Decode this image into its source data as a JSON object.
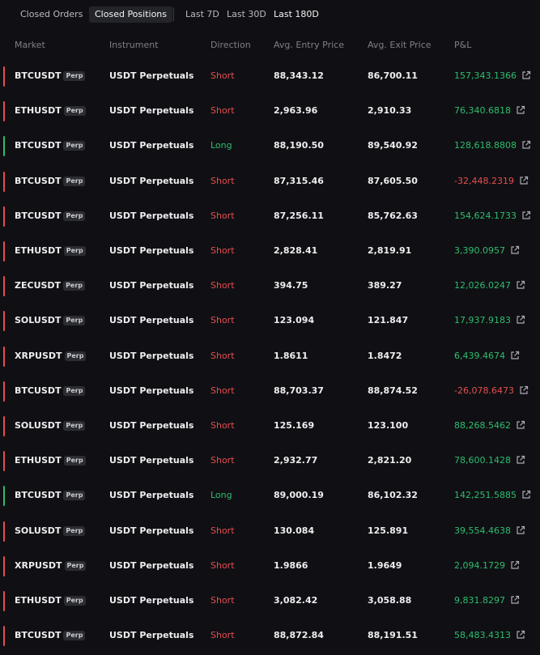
{
  "colors": {
    "short": "#e54e4e",
    "long": "#2ebd6e",
    "positive": "#2ebd6e",
    "negative": "#e54e4e"
  },
  "tabs": {
    "closed_orders": "Closed Orders",
    "closed_positions": "Closed Positions",
    "last_7d": "Last 7D",
    "last_30d": "Last 30D",
    "last_180d": "Last 180D"
  },
  "columns": {
    "market": "Market",
    "instrument": "Instrument",
    "direction": "Direction",
    "entry": "Avg. Entry Price",
    "exit": "Avg. Exit Price",
    "pnl": "P&L"
  },
  "badge_label": "Perp",
  "rows": [
    {
      "market": "BTCUSDT",
      "instrument": "USDT Perpetuals",
      "direction": "Short",
      "entry": "88,343.12",
      "exit": "86,700.11",
      "pnl": "157,343.1366"
    },
    {
      "market": "ETHUSDT",
      "instrument": "USDT Perpetuals",
      "direction": "Short",
      "entry": "2,963.96",
      "exit": "2,910.33",
      "pnl": "76,340.6818"
    },
    {
      "market": "BTCUSDT",
      "instrument": "USDT Perpetuals",
      "direction": "Long",
      "entry": "88,190.50",
      "exit": "89,540.92",
      "pnl": "128,618.8808"
    },
    {
      "market": "BTCUSDT",
      "instrument": "USDT Perpetuals",
      "direction": "Short",
      "entry": "87,315.46",
      "exit": "87,605.50",
      "pnl": "-32,448.2319"
    },
    {
      "market": "BTCUSDT",
      "instrument": "USDT Perpetuals",
      "direction": "Short",
      "entry": "87,256.11",
      "exit": "85,762.63",
      "pnl": "154,624.1733"
    },
    {
      "market": "ETHUSDT",
      "instrument": "USDT Perpetuals",
      "direction": "Short",
      "entry": "2,828.41",
      "exit": "2,819.91",
      "pnl": "3,390.0957"
    },
    {
      "market": "ZECUSDT",
      "instrument": "USDT Perpetuals",
      "direction": "Short",
      "entry": "394.75",
      "exit": "389.27",
      "pnl": "12,026.0247"
    },
    {
      "market": "SOLUSDT",
      "instrument": "USDT Perpetuals",
      "direction": "Short",
      "entry": "123.094",
      "exit": "121.847",
      "pnl": "17,937.9183"
    },
    {
      "market": "XRPUSDT",
      "instrument": "USDT Perpetuals",
      "direction": "Short",
      "entry": "1.8611",
      "exit": "1.8472",
      "pnl": "6,439.4674"
    },
    {
      "market": "BTCUSDT",
      "instrument": "USDT Perpetuals",
      "direction": "Short",
      "entry": "88,703.37",
      "exit": "88,874.52",
      "pnl": "-26,078.6473"
    },
    {
      "market": "SOLUSDT",
      "instrument": "USDT Perpetuals",
      "direction": "Short",
      "entry": "125.169",
      "exit": "123.100",
      "pnl": "88,268.5462"
    },
    {
      "market": "ETHUSDT",
      "instrument": "USDT Perpetuals",
      "direction": "Short",
      "entry": "2,932.77",
      "exit": "2,821.20",
      "pnl": "78,600.1428"
    },
    {
      "market": "BTCUSDT",
      "instrument": "USDT Perpetuals",
      "direction": "Long",
      "entry": "89,000.19",
      "exit": "86,102.32",
      "pnl": "142,251.5885"
    },
    {
      "market": "SOLUSDT",
      "instrument": "USDT Perpetuals",
      "direction": "Short",
      "entry": "130.084",
      "exit": "125.891",
      "pnl": "39,554.4638"
    },
    {
      "market": "XRPUSDT",
      "instrument": "USDT Perpetuals",
      "direction": "Short",
      "entry": "1.9866",
      "exit": "1.9649",
      "pnl": "2,094.1729"
    },
    {
      "market": "ETHUSDT",
      "instrument": "USDT Perpetuals",
      "direction": "Short",
      "entry": "3,082.42",
      "exit": "3,058.88",
      "pnl": "9,831.8297"
    },
    {
      "market": "BTCUSDT",
      "instrument": "USDT Perpetuals",
      "direction": "Short",
      "entry": "88,872.84",
      "exit": "88,191.51",
      "pnl": "58,483.4313"
    }
  ]
}
